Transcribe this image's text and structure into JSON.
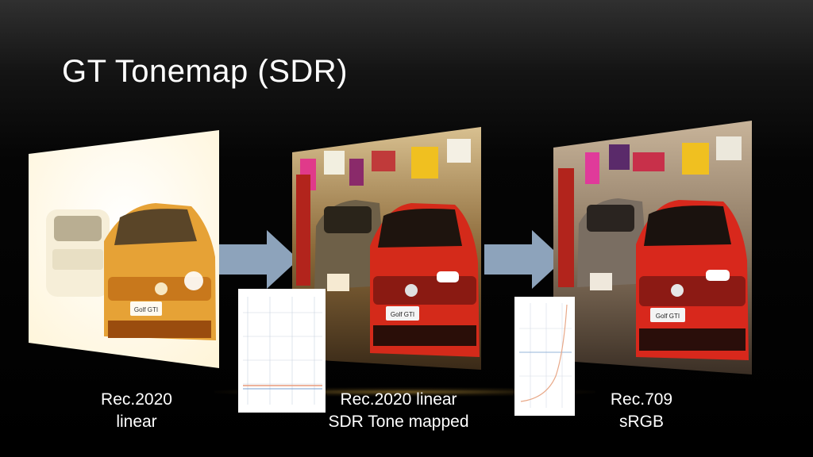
{
  "slide": {
    "title": "GT Tonemap (SDR)"
  },
  "panels": [
    {
      "caption_line1": "Rec.2020",
      "caption_line2": "linear"
    },
    {
      "caption_line1": "Rec.2020 linear",
      "caption_line2": "SDR Tone mapped"
    },
    {
      "caption_line1": "Rec.709",
      "caption_line2": "sRGB"
    }
  ],
  "badge_text": "Golf GTI",
  "colors": {
    "arrow": "#8da3bb",
    "car_red": "#d42a1a",
    "overexposed": "#fff6dc"
  }
}
